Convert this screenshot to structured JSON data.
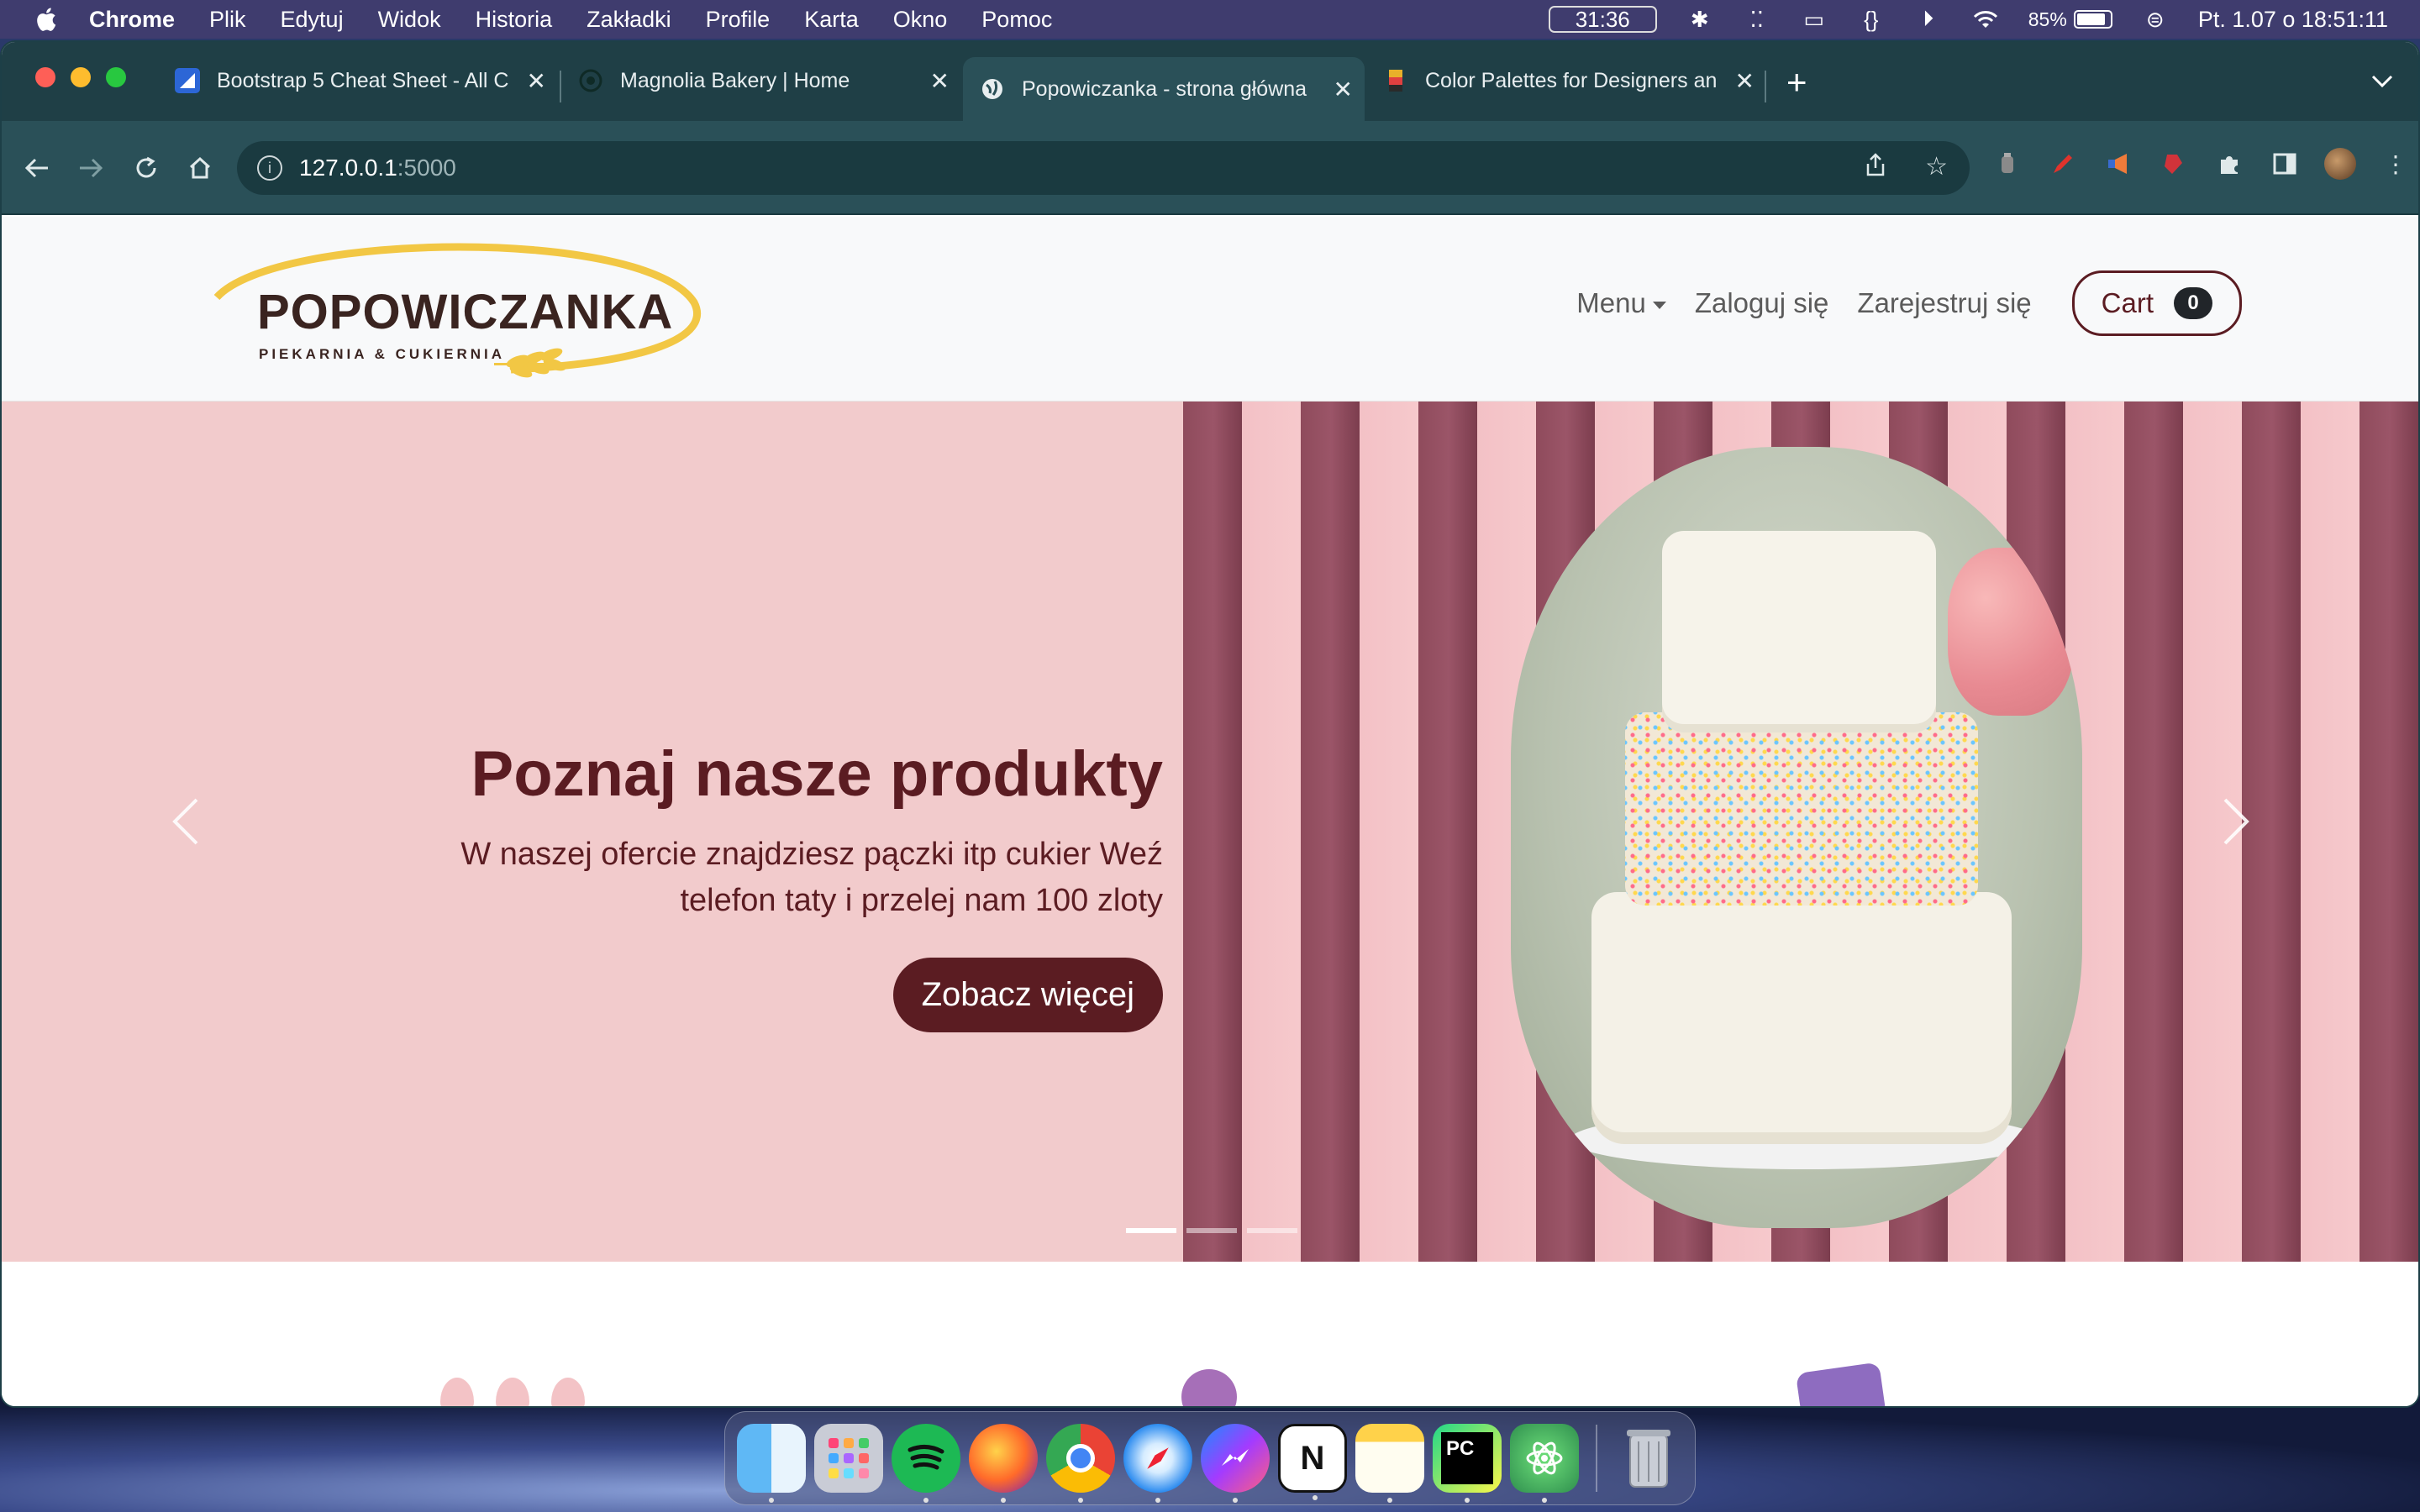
{
  "menubar": {
    "app": "Chrome",
    "items": [
      "Plik",
      "Edytuj",
      "Widok",
      "Historia",
      "Zakładki",
      "Profile",
      "Karta",
      "Okno",
      "Pomoc"
    ],
    "timer": "31:36",
    "battery": "85%",
    "datetime": "Pt. 1.07 o  18:51:11"
  },
  "tabs": [
    {
      "title": "Bootstrap 5 Cheat Sheet - All C",
      "favicon": "bootstrap-icon",
      "color": "#2c66d6"
    },
    {
      "title": "Magnolia Bakery | Home",
      "favicon": "magnolia-icon",
      "color": "#23443f"
    },
    {
      "title": "Popowiczanka - strona główna",
      "favicon": "globe-icon",
      "color": "#ffffff",
      "active": true
    },
    {
      "title": "Color Palettes for Designers an",
      "favicon": "palette-icon",
      "color": "#e8b02a"
    }
  ],
  "address": {
    "host": "127.0.0.1",
    "port": ":5000"
  },
  "site": {
    "logo_title": "POPOWICZANKA",
    "logo_sub": "PIEKARNIA & CUKIERNIA",
    "nav": {
      "menu": "Menu",
      "login": "Zaloguj się",
      "register": "Zarejestruj się",
      "cart": "Cart",
      "cart_count": "0"
    },
    "hero": {
      "title": "Poznaj nasze produkty",
      "text": "W naszej ofercie znajdziesz pączki itp cukier Weź telefon taty i przelej nam 100 zloty",
      "button": "Zobacz więcej",
      "slides": 3,
      "active_slide": 1
    }
  },
  "colors": {
    "brand": "#5b1c22",
    "hero_bg": "#f2cbcc",
    "logo_gold": "#f2c744",
    "chrome_frame": "#1f3f46"
  },
  "dock": [
    "Finder",
    "Launchpad",
    "Spotify",
    "Firefox",
    "Chrome",
    "Safari",
    "Messenger",
    "Notion",
    "Notes",
    "PyCharm",
    "Atom",
    "Trash"
  ]
}
